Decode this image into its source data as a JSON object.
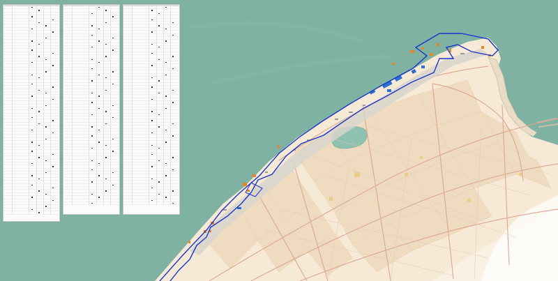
{
  "map": {
    "colors": {
      "sea": "#7fb2a2",
      "land": "#f6ead6",
      "block": "#efdcc0",
      "boundary": "#1a35c9",
      "road": "#d9a58f",
      "orange_building": "#e0882b",
      "blue_building": "#2f6fcf",
      "table_bg": "#fbfbfb"
    },
    "features": [
      "coastline",
      "port-boundary",
      "inland-lake",
      "urban-blocks",
      "main-roads",
      "harbor-pier"
    ]
  },
  "tables": [
    {
      "title": "",
      "headers": [
        "",
        ""
      ]
    },
    {
      "title": "",
      "headers": [
        "",
        ""
      ]
    },
    {
      "title": "",
      "headers": [
        "",
        ""
      ]
    }
  ]
}
